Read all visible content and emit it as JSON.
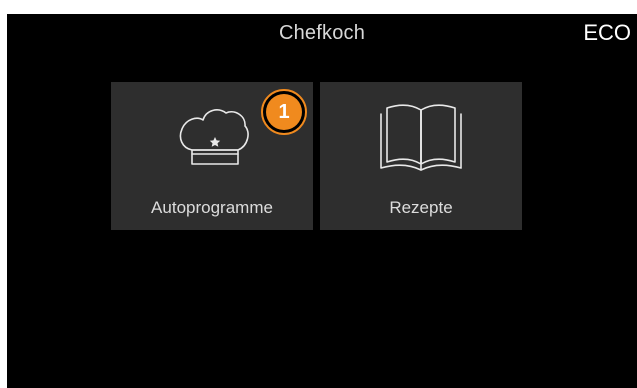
{
  "header": {
    "title": "Chefkoch",
    "eco_label": "ECO"
  },
  "tiles": [
    {
      "label": "Autoprogramme",
      "icon": "chef-hat-icon"
    },
    {
      "label": "Rezepte",
      "icon": "book-icon"
    }
  ],
  "badge": {
    "number": "1",
    "color": "#f08a1e"
  },
  "colors": {
    "background": "#000000",
    "tile": "#2e2e2e",
    "text": "#dcdcdc",
    "accent": "#f08a1e"
  }
}
